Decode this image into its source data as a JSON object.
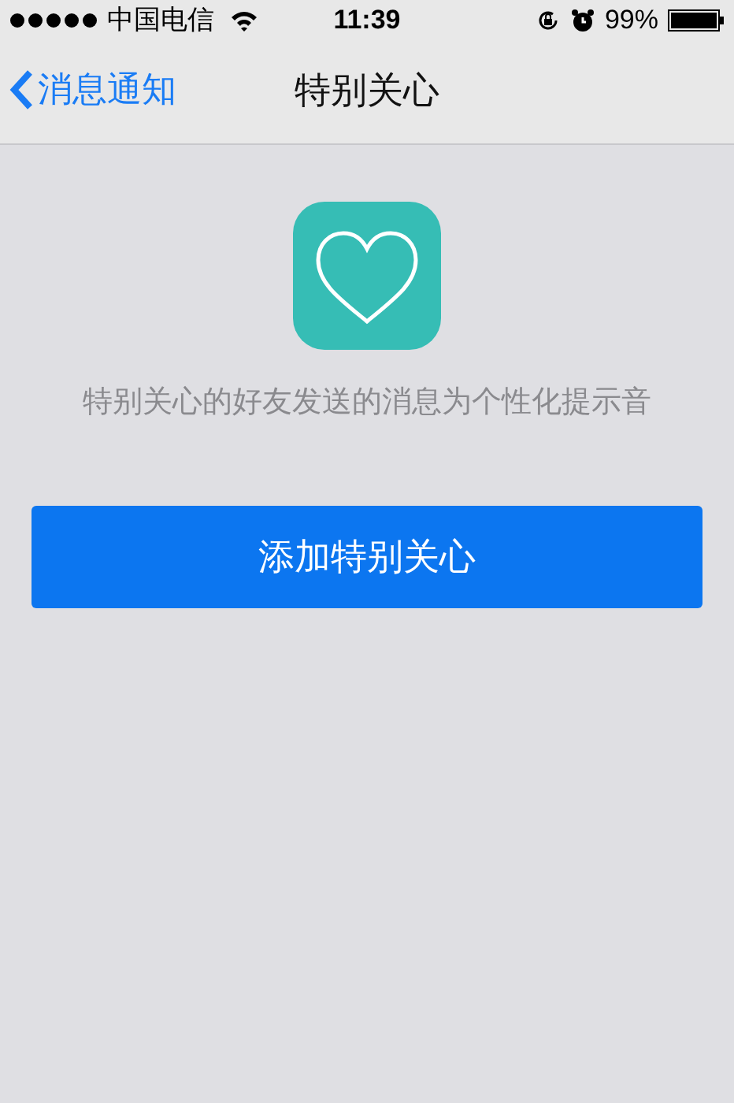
{
  "status_bar": {
    "carrier": "中国电信",
    "time": "11:39",
    "battery": "99%"
  },
  "nav_bar": {
    "back": "消息通知",
    "title": "特别关心"
  },
  "description": "特别关心的好友发送的消息为个性化提示音",
  "add_button": "添加特别关心"
}
